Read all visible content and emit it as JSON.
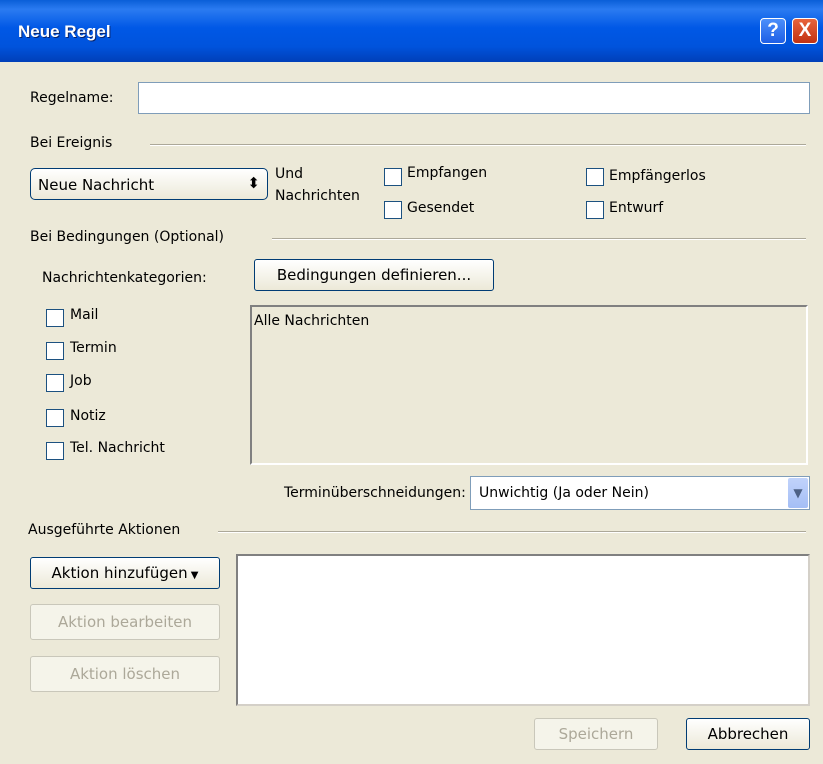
{
  "window": {
    "title": "Neue Regel",
    "help_icon": "?",
    "close_icon": "X"
  },
  "rule_name": {
    "label": "Regelname:",
    "value": ""
  },
  "event_section": {
    "heading": "Bei Ereignis",
    "event_select": {
      "value": "Neue Nachricht",
      "icon": "updown-arrows"
    },
    "und_label": "Und",
    "nachrichten_label": "Nachrichten",
    "checkboxes": {
      "empfangen": {
        "label": "Empfangen",
        "checked": false
      },
      "gesendet": {
        "label": "Gesendet",
        "checked": false
      },
      "empfaengerlos": {
        "label": "Empfängerlos",
        "checked": false
      },
      "entwurf": {
        "label": "Entwurf",
        "checked": false
      }
    }
  },
  "conditions_section": {
    "heading": "Bei Bedingungen  (Optional)",
    "categories_label": "Nachrichtenkategorien:",
    "define_button": "Bedingungen definieren...",
    "categories": [
      {
        "label": "Mail",
        "checked": false
      },
      {
        "label": "Termin",
        "checked": false
      },
      {
        "label": "Job",
        "checked": false
      },
      {
        "label": "Notiz",
        "checked": false
      },
      {
        "label": "Tel. Nachricht",
        "checked": false
      }
    ],
    "conditions_text": "Alle Nachrichten",
    "overlap_label": "Terminüberschneidungen:",
    "overlap_select": "Unwichtig (Ja oder Nein)"
  },
  "actions_section": {
    "heading": "Ausgeführte Aktionen",
    "add_button": "Aktion hinzufügen",
    "edit_button": "Aktion bearbeiten",
    "delete_button": "Aktion löschen"
  },
  "footer": {
    "save_button": "Speichern",
    "cancel_button": "Abbrechen"
  }
}
